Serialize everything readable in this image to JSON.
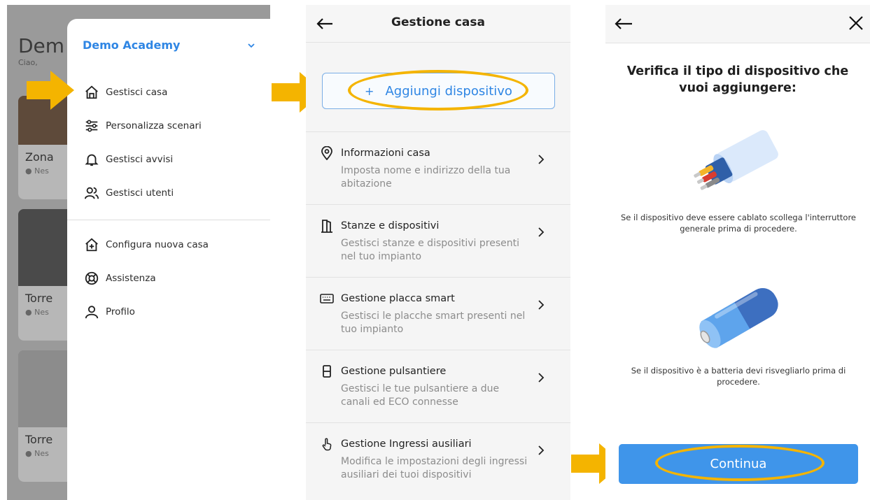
{
  "panel1": {
    "background": {
      "title": "Dem",
      "subtitle": "Ciao,",
      "cards": [
        {
          "title": "Zona",
          "status": "Nes"
        },
        {
          "title": "Torre",
          "status": "Nes"
        },
        {
          "title": "Torre",
          "status": "Nes"
        }
      ]
    },
    "drawer": {
      "house_name": "Demo Academy",
      "items": [
        {
          "label": "Gestisci casa",
          "icon": "home-icon"
        },
        {
          "label": "Personalizza scenari",
          "icon": "sliders-icon"
        },
        {
          "label": "Gestisci avvisi",
          "icon": "bell-icon"
        },
        {
          "label": "Gestisci utenti",
          "icon": "users-icon"
        }
      ],
      "items2": [
        {
          "label": "Configura nuova casa",
          "icon": "home-add-icon"
        },
        {
          "label": "Assistenza",
          "icon": "lifebuoy-icon"
        },
        {
          "label": "Profilo",
          "icon": "user-icon"
        }
      ]
    }
  },
  "panel2": {
    "title": "Gestione casa",
    "add_button": {
      "plus": "+",
      "label": "Aggiungi dispositivo"
    },
    "rows": [
      {
        "title": "Informazioni casa",
        "subtitle": "Imposta nome e indirizzo della tua abitazione",
        "icon": "location-pin-icon"
      },
      {
        "title": "Stanze e dispositivi",
        "subtitle": "Gestisci stanze e dispositivi presenti nel tuo impianto",
        "icon": "door-icon"
      },
      {
        "title": "Gestione placca smart",
        "subtitle": "Gestisci le placche smart presenti nel tuo impianto",
        "icon": "keyboard-icon"
      },
      {
        "title": "Gestione pulsantiere",
        "subtitle": "Gestisci le tue pulsantiere a due canali ed ECO connesse",
        "icon": "switch-icon"
      },
      {
        "title": "Gestione Ingressi ausiliari",
        "subtitle": "Modifica le impostazioni degli ingressi ausiliari dei tuoi dispositivi",
        "icon": "touch-icon"
      }
    ]
  },
  "panel3": {
    "heading": "Verifica il tipo di dispositivo che vuoi aggiungere:",
    "cable_note": "Se il dispositivo deve essere cablato scollega l'interruttore generale prima di procedere.",
    "battery_note": "Se il dispositivo è a batteria devi risvegliarlo prima di procedere.",
    "continue_label": "Continua"
  },
  "colors": {
    "accent": "#2f86e4",
    "button": "#3f95ea",
    "highlight": "#f4b400"
  }
}
